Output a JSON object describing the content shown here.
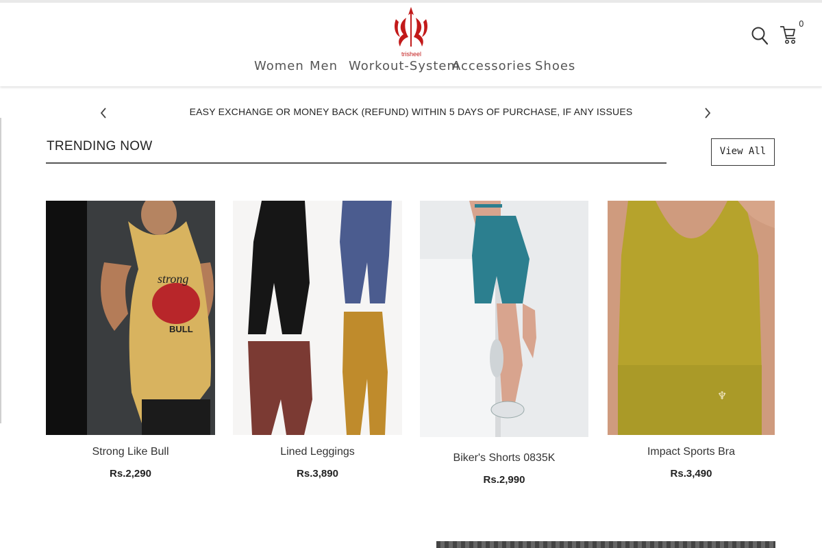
{
  "brand": {
    "logo_text": "trisheel"
  },
  "nav": [
    {
      "label": "Women"
    },
    {
      "label": "Men"
    },
    {
      "label": "Workout-System"
    },
    {
      "label": "Accessories"
    },
    {
      "label": "Shoes"
    }
  ],
  "header": {
    "cart_count": "0",
    "icons": [
      "search-icon",
      "cart-icon"
    ]
  },
  "announcement": {
    "text": "EASY EXCHANGE OR MONEY BACK (REFUND) WITHIN 5 DAYS OF PURCHASE, IF ANY ISSUES"
  },
  "trending": {
    "title": "TRENDING NOW",
    "view_all": "View All",
    "products": [
      {
        "name": "Strong Like Bull",
        "price": "Rs.2,290"
      },
      {
        "name": "Lined Leggings",
        "price": "Rs.3,890"
      },
      {
        "name": "Biker's Shorts 0835K",
        "price": "Rs.2,990"
      },
      {
        "name": "Impact Sports Bra",
        "price": "Rs.3,490"
      }
    ]
  },
  "colors": {
    "brand_red": "#c21a1a",
    "text_dark": "#222222",
    "nav_grey": "#555555"
  }
}
